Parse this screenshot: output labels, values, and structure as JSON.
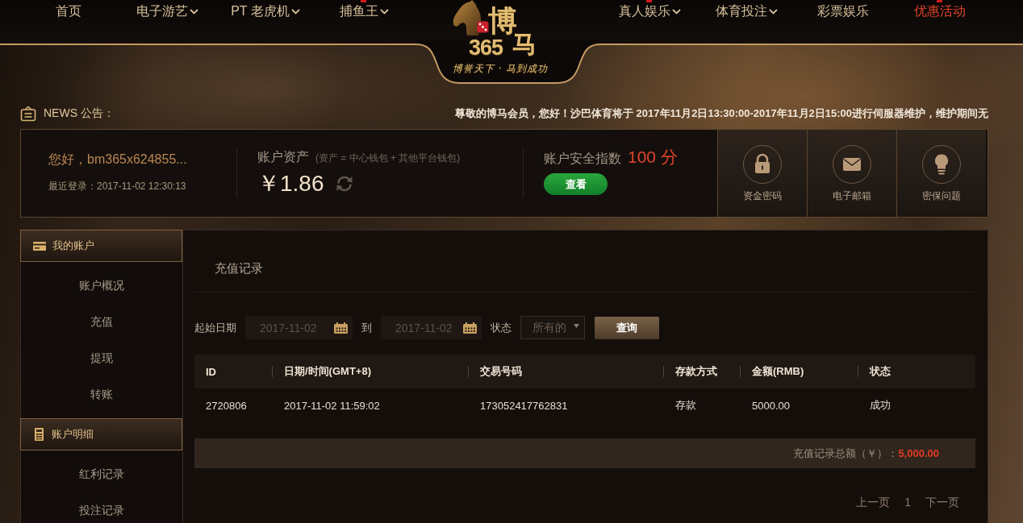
{
  "nav": {
    "left": [
      {
        "label": "首页",
        "dropdown": false,
        "accent": false,
        "badge": false
      },
      {
        "label": "电子游艺",
        "dropdown": true,
        "accent": false,
        "badge": false
      },
      {
        "label": "PT 老虎机",
        "dropdown": true,
        "accent": false,
        "badge": false
      },
      {
        "label": "捕鱼王",
        "dropdown": true,
        "accent": false,
        "badge": true
      }
    ],
    "right": [
      {
        "label": "真人娱乐",
        "dropdown": true,
        "accent": false,
        "badge": true
      },
      {
        "label": "体育投注",
        "dropdown": true,
        "accent": false,
        "badge": false
      },
      {
        "label": "彩票娱乐",
        "dropdown": false,
        "accent": false,
        "badge": false
      },
      {
        "label": "优惠活动",
        "dropdown": false,
        "accent": true,
        "badge": true
      }
    ]
  },
  "logo": {
    "title_char": "博",
    "number": "365",
    "side_char": "马",
    "slogan": "博誉天下 · 马到成功"
  },
  "news": {
    "label": "NEWS 公告：",
    "message": "尊敬的博马会员，您好！沙巴体育将于 2017年11月2日13:30:00-2017年11月2日15:00进行伺服器维护，维护期间无"
  },
  "account": {
    "greeting": "您好，bm365x624855...",
    "last_login": "最近登录：2017-11-02 12:30:13",
    "assets_label": "账户资产",
    "assets_note": "(资产 = 中心钱包 + 其他平台钱包)",
    "balance": "￥1.86",
    "security_label": "账户安全指数",
    "security_score": "100 分",
    "view_button": "查看",
    "shortcuts": [
      {
        "kind": "fund_password",
        "label": "资金密码"
      },
      {
        "kind": "email",
        "label": "电子邮箱"
      },
      {
        "kind": "security_question",
        "label": "密保问题"
      }
    ]
  },
  "sidebar": {
    "sections": [
      {
        "kind": "account",
        "title": "我的账户",
        "items": [
          "账户概况",
          "充值",
          "提现",
          "转账"
        ]
      },
      {
        "kind": "details",
        "title": "账户明细",
        "items": [
          "红利记录",
          "投注记录"
        ]
      }
    ]
  },
  "main": {
    "title": "充值记录",
    "filter": {
      "start_label": "起始日期",
      "start_value": "2017-11-02",
      "to_label": "到",
      "end_value": "2017-11-02",
      "status_label": "状态",
      "status_value": "所有的",
      "query_button": "查询"
    },
    "table": {
      "columns": [
        "ID",
        "日期/时间(GMT+8)",
        "交易号码",
        "存款方式",
        "金额(RMB)",
        "状态"
      ],
      "rows": [
        [
          "2720806",
          "2017-11-02 11:59:02",
          "173052417762831",
          "存款",
          "5000.00",
          "成功"
        ]
      ]
    },
    "total": {
      "label": "充值记录总额（￥）：",
      "value": "5,000.00"
    },
    "pagination": {
      "prev": "上一页",
      "pages": [
        "1"
      ],
      "next": "下一页"
    }
  }
}
